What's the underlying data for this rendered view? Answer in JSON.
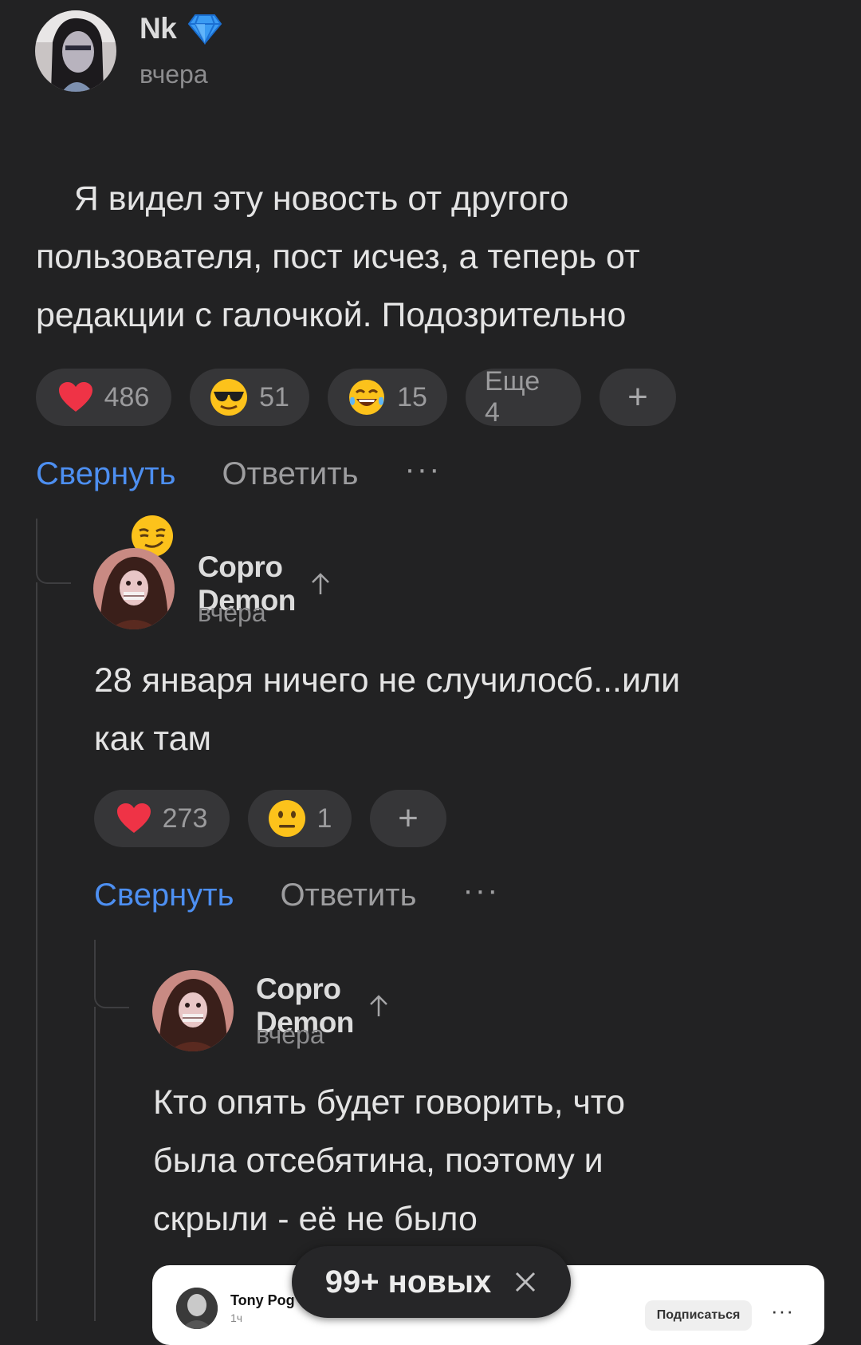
{
  "comments": [
    {
      "author": "Nk",
      "badge_icon": "diamond-icon",
      "time": "вчера",
      "text": "Я видел эту новость от другого пользователя, пост исчез, а теперь от редакции с галочкой. Подозрительно",
      "trailing_emoji": "smirk-emoji-icon",
      "reactions": [
        {
          "icon": "heart-icon",
          "count": "486"
        },
        {
          "icon": "sunglasses-emoji-icon",
          "count": "51"
        },
        {
          "icon": "tears-of-joy-emoji-icon",
          "count": "15"
        }
      ],
      "more_reactions_label": "Еще 4",
      "add_reaction_label": "+",
      "actions": {
        "collapse": "Свернуть",
        "reply": "Ответить",
        "more": "···"
      }
    },
    {
      "author": "Copro Demon",
      "badge_icon": "arrow-up-icon",
      "time": "вчера",
      "text": "28 января ничего не случилосб...или\nкак там",
      "reactions": [
        {
          "icon": "heart-icon",
          "count": "273"
        },
        {
          "icon": "neutral-face-emoji-icon",
          "count": "1"
        }
      ],
      "add_reaction_label": "+",
      "actions": {
        "collapse": "Свернуть",
        "reply": "Ответить",
        "more": "···"
      }
    },
    {
      "author": "Copro Demon",
      "badge_icon": "arrow-up-icon",
      "time": "вчера",
      "text": "Кто опять будет говорить, что\nбыла отсебятина, поэтому и\nскрыли - её не было"
    }
  ],
  "embed": {
    "author": "Tony Pog",
    "sub": "1ч",
    "subscribe_label": "Подписаться",
    "more": "···"
  },
  "new_notice": {
    "label": "99+ новых",
    "close_icon": "close-icon"
  },
  "colors": {
    "background": "#222223",
    "accent": "#4d8ff1",
    "chip": "#363638",
    "muted_text": "#9d9d9f"
  }
}
